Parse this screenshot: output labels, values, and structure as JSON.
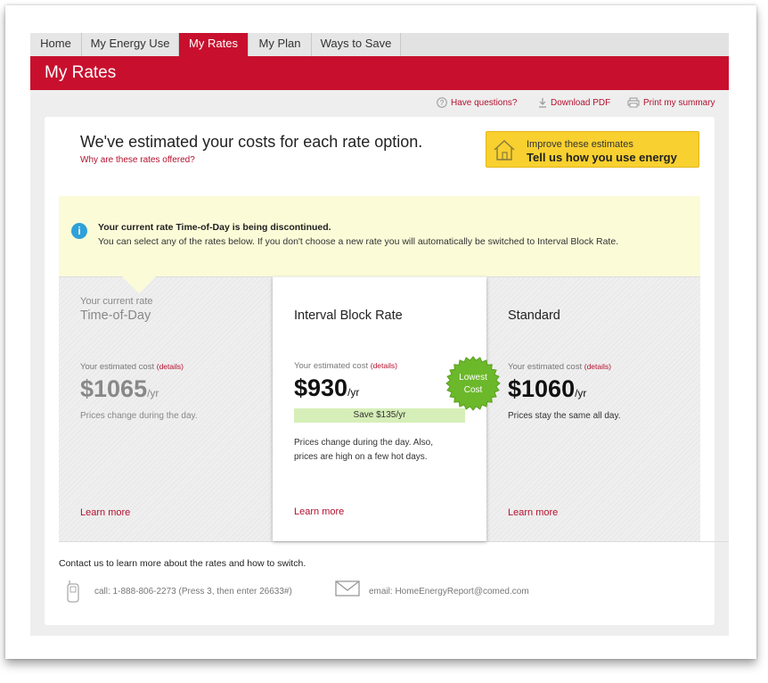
{
  "tabs": [
    {
      "label": "Home"
    },
    {
      "label": "My Energy Use"
    },
    {
      "label": "My Rates"
    },
    {
      "label": "My Plan"
    },
    {
      "label": "Ways to Save"
    }
  ],
  "active_tab": "My Rates",
  "page_title": "My Rates",
  "utility_links": {
    "questions": "Have questions?",
    "download": "Download PDF",
    "print": "Print my summary"
  },
  "headline": "We've estimated your costs for each rate option.",
  "why_link": "Why are these rates offered?",
  "improve": {
    "line1": "Improve these estimates",
    "line2": "Tell us how you use energy"
  },
  "notice": {
    "title": "Your current rate Time-of-Day is being discontinued.",
    "body": "You can select any of the rates below. If you don't choose a new rate you will automatically be switched to Interval Block Rate."
  },
  "rates": [
    {
      "current_label": "Your current rate",
      "name": "Time-of-Day",
      "est_label": "Your estimated cost",
      "details": "(details)",
      "price": "$1065",
      "per": "/yr",
      "description": "Prices change during the day.",
      "learn": "Learn more"
    },
    {
      "name": "Interval Block Rate",
      "est_label": "Your estimated cost",
      "details": "(details)",
      "price": "$930",
      "per": "/yr",
      "savings": "Save $135/yr",
      "description_1": "Prices change during the day. Also,",
      "description_2": "prices are high on a few hot days.",
      "learn": "Learn more",
      "badge_1": "Lowest",
      "badge_2": "Cost"
    },
    {
      "name": "Standard",
      "est_label": "Your estimated cost",
      "details": "(details)",
      "price": "$1060",
      "per": "/yr",
      "description": "Prices stay the same all day.",
      "learn": "Learn more"
    }
  ],
  "contact": {
    "heading": "Contact us to learn more about the rates and how to switch.",
    "call": "call: 1-888-806-2273 (Press 3, then enter 26633#)",
    "email": "email: HomeEnergyReport@comed.com"
  },
  "colors": {
    "brand_red": "#c8102e",
    "link_red": "#b3112e",
    "notice_yellow": "#fbfbd8",
    "cta_yellow": "#f8d030",
    "badge_green": "#6bb82a",
    "savings_green": "#d6efb8"
  }
}
